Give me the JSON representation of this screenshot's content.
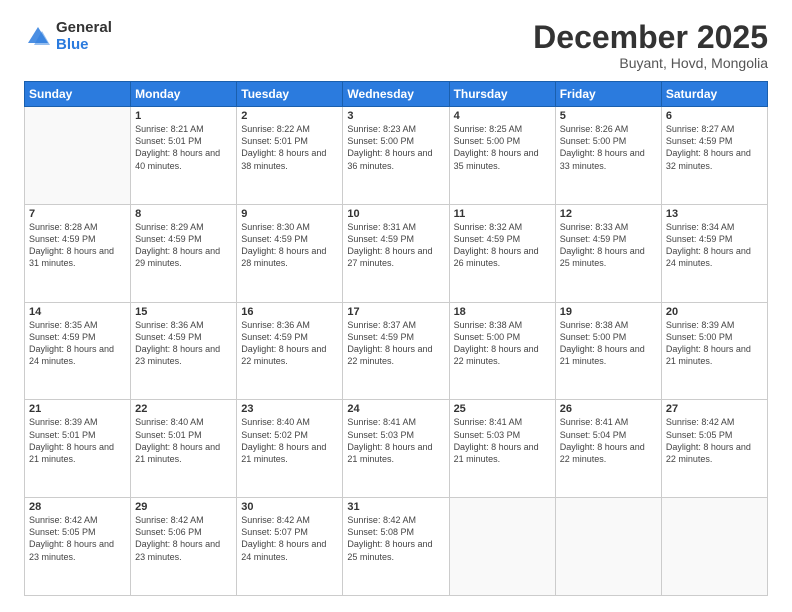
{
  "logo": {
    "general": "General",
    "blue": "Blue"
  },
  "header": {
    "month": "December 2025",
    "location": "Buyant, Hovd, Mongolia"
  },
  "weekdays": [
    "Sunday",
    "Monday",
    "Tuesday",
    "Wednesday",
    "Thursday",
    "Friday",
    "Saturday"
  ],
  "weeks": [
    [
      {
        "day": "",
        "sunrise": "",
        "sunset": "",
        "daylight": ""
      },
      {
        "day": "1",
        "sunrise": "Sunrise: 8:21 AM",
        "sunset": "Sunset: 5:01 PM",
        "daylight": "Daylight: 8 hours and 40 minutes."
      },
      {
        "day": "2",
        "sunrise": "Sunrise: 8:22 AM",
        "sunset": "Sunset: 5:01 PM",
        "daylight": "Daylight: 8 hours and 38 minutes."
      },
      {
        "day": "3",
        "sunrise": "Sunrise: 8:23 AM",
        "sunset": "Sunset: 5:00 PM",
        "daylight": "Daylight: 8 hours and 36 minutes."
      },
      {
        "day": "4",
        "sunrise": "Sunrise: 8:25 AM",
        "sunset": "Sunset: 5:00 PM",
        "daylight": "Daylight: 8 hours and 35 minutes."
      },
      {
        "day": "5",
        "sunrise": "Sunrise: 8:26 AM",
        "sunset": "Sunset: 5:00 PM",
        "daylight": "Daylight: 8 hours and 33 minutes."
      },
      {
        "day": "6",
        "sunrise": "Sunrise: 8:27 AM",
        "sunset": "Sunset: 4:59 PM",
        "daylight": "Daylight: 8 hours and 32 minutes."
      }
    ],
    [
      {
        "day": "7",
        "sunrise": "Sunrise: 8:28 AM",
        "sunset": "Sunset: 4:59 PM",
        "daylight": "Daylight: 8 hours and 31 minutes."
      },
      {
        "day": "8",
        "sunrise": "Sunrise: 8:29 AM",
        "sunset": "Sunset: 4:59 PM",
        "daylight": "Daylight: 8 hours and 29 minutes."
      },
      {
        "day": "9",
        "sunrise": "Sunrise: 8:30 AM",
        "sunset": "Sunset: 4:59 PM",
        "daylight": "Daylight: 8 hours and 28 minutes."
      },
      {
        "day": "10",
        "sunrise": "Sunrise: 8:31 AM",
        "sunset": "Sunset: 4:59 PM",
        "daylight": "Daylight: 8 hours and 27 minutes."
      },
      {
        "day": "11",
        "sunrise": "Sunrise: 8:32 AM",
        "sunset": "Sunset: 4:59 PM",
        "daylight": "Daylight: 8 hours and 26 minutes."
      },
      {
        "day": "12",
        "sunrise": "Sunrise: 8:33 AM",
        "sunset": "Sunset: 4:59 PM",
        "daylight": "Daylight: 8 hours and 25 minutes."
      },
      {
        "day": "13",
        "sunrise": "Sunrise: 8:34 AM",
        "sunset": "Sunset: 4:59 PM",
        "daylight": "Daylight: 8 hours and 24 minutes."
      }
    ],
    [
      {
        "day": "14",
        "sunrise": "Sunrise: 8:35 AM",
        "sunset": "Sunset: 4:59 PM",
        "daylight": "Daylight: 8 hours and 24 minutes."
      },
      {
        "day": "15",
        "sunrise": "Sunrise: 8:36 AM",
        "sunset": "Sunset: 4:59 PM",
        "daylight": "Daylight: 8 hours and 23 minutes."
      },
      {
        "day": "16",
        "sunrise": "Sunrise: 8:36 AM",
        "sunset": "Sunset: 4:59 PM",
        "daylight": "Daylight: 8 hours and 22 minutes."
      },
      {
        "day": "17",
        "sunrise": "Sunrise: 8:37 AM",
        "sunset": "Sunset: 4:59 PM",
        "daylight": "Daylight: 8 hours and 22 minutes."
      },
      {
        "day": "18",
        "sunrise": "Sunrise: 8:38 AM",
        "sunset": "Sunset: 5:00 PM",
        "daylight": "Daylight: 8 hours and 22 minutes."
      },
      {
        "day": "19",
        "sunrise": "Sunrise: 8:38 AM",
        "sunset": "Sunset: 5:00 PM",
        "daylight": "Daylight: 8 hours and 21 minutes."
      },
      {
        "day": "20",
        "sunrise": "Sunrise: 8:39 AM",
        "sunset": "Sunset: 5:00 PM",
        "daylight": "Daylight: 8 hours and 21 minutes."
      }
    ],
    [
      {
        "day": "21",
        "sunrise": "Sunrise: 8:39 AM",
        "sunset": "Sunset: 5:01 PM",
        "daylight": "Daylight: 8 hours and 21 minutes."
      },
      {
        "day": "22",
        "sunrise": "Sunrise: 8:40 AM",
        "sunset": "Sunset: 5:01 PM",
        "daylight": "Daylight: 8 hours and 21 minutes."
      },
      {
        "day": "23",
        "sunrise": "Sunrise: 8:40 AM",
        "sunset": "Sunset: 5:02 PM",
        "daylight": "Daylight: 8 hours and 21 minutes."
      },
      {
        "day": "24",
        "sunrise": "Sunrise: 8:41 AM",
        "sunset": "Sunset: 5:03 PM",
        "daylight": "Daylight: 8 hours and 21 minutes."
      },
      {
        "day": "25",
        "sunrise": "Sunrise: 8:41 AM",
        "sunset": "Sunset: 5:03 PM",
        "daylight": "Daylight: 8 hours and 21 minutes."
      },
      {
        "day": "26",
        "sunrise": "Sunrise: 8:41 AM",
        "sunset": "Sunset: 5:04 PM",
        "daylight": "Daylight: 8 hours and 22 minutes."
      },
      {
        "day": "27",
        "sunrise": "Sunrise: 8:42 AM",
        "sunset": "Sunset: 5:05 PM",
        "daylight": "Daylight: 8 hours and 22 minutes."
      }
    ],
    [
      {
        "day": "28",
        "sunrise": "Sunrise: 8:42 AM",
        "sunset": "Sunset: 5:05 PM",
        "daylight": "Daylight: 8 hours and 23 minutes."
      },
      {
        "day": "29",
        "sunrise": "Sunrise: 8:42 AM",
        "sunset": "Sunset: 5:06 PM",
        "daylight": "Daylight: 8 hours and 23 minutes."
      },
      {
        "day": "30",
        "sunrise": "Sunrise: 8:42 AM",
        "sunset": "Sunset: 5:07 PM",
        "daylight": "Daylight: 8 hours and 24 minutes."
      },
      {
        "day": "31",
        "sunrise": "Sunrise: 8:42 AM",
        "sunset": "Sunset: 5:08 PM",
        "daylight": "Daylight: 8 hours and 25 minutes."
      },
      {
        "day": "",
        "sunrise": "",
        "sunset": "",
        "daylight": ""
      },
      {
        "day": "",
        "sunrise": "",
        "sunset": "",
        "daylight": ""
      },
      {
        "day": "",
        "sunrise": "",
        "sunset": "",
        "daylight": ""
      }
    ]
  ]
}
